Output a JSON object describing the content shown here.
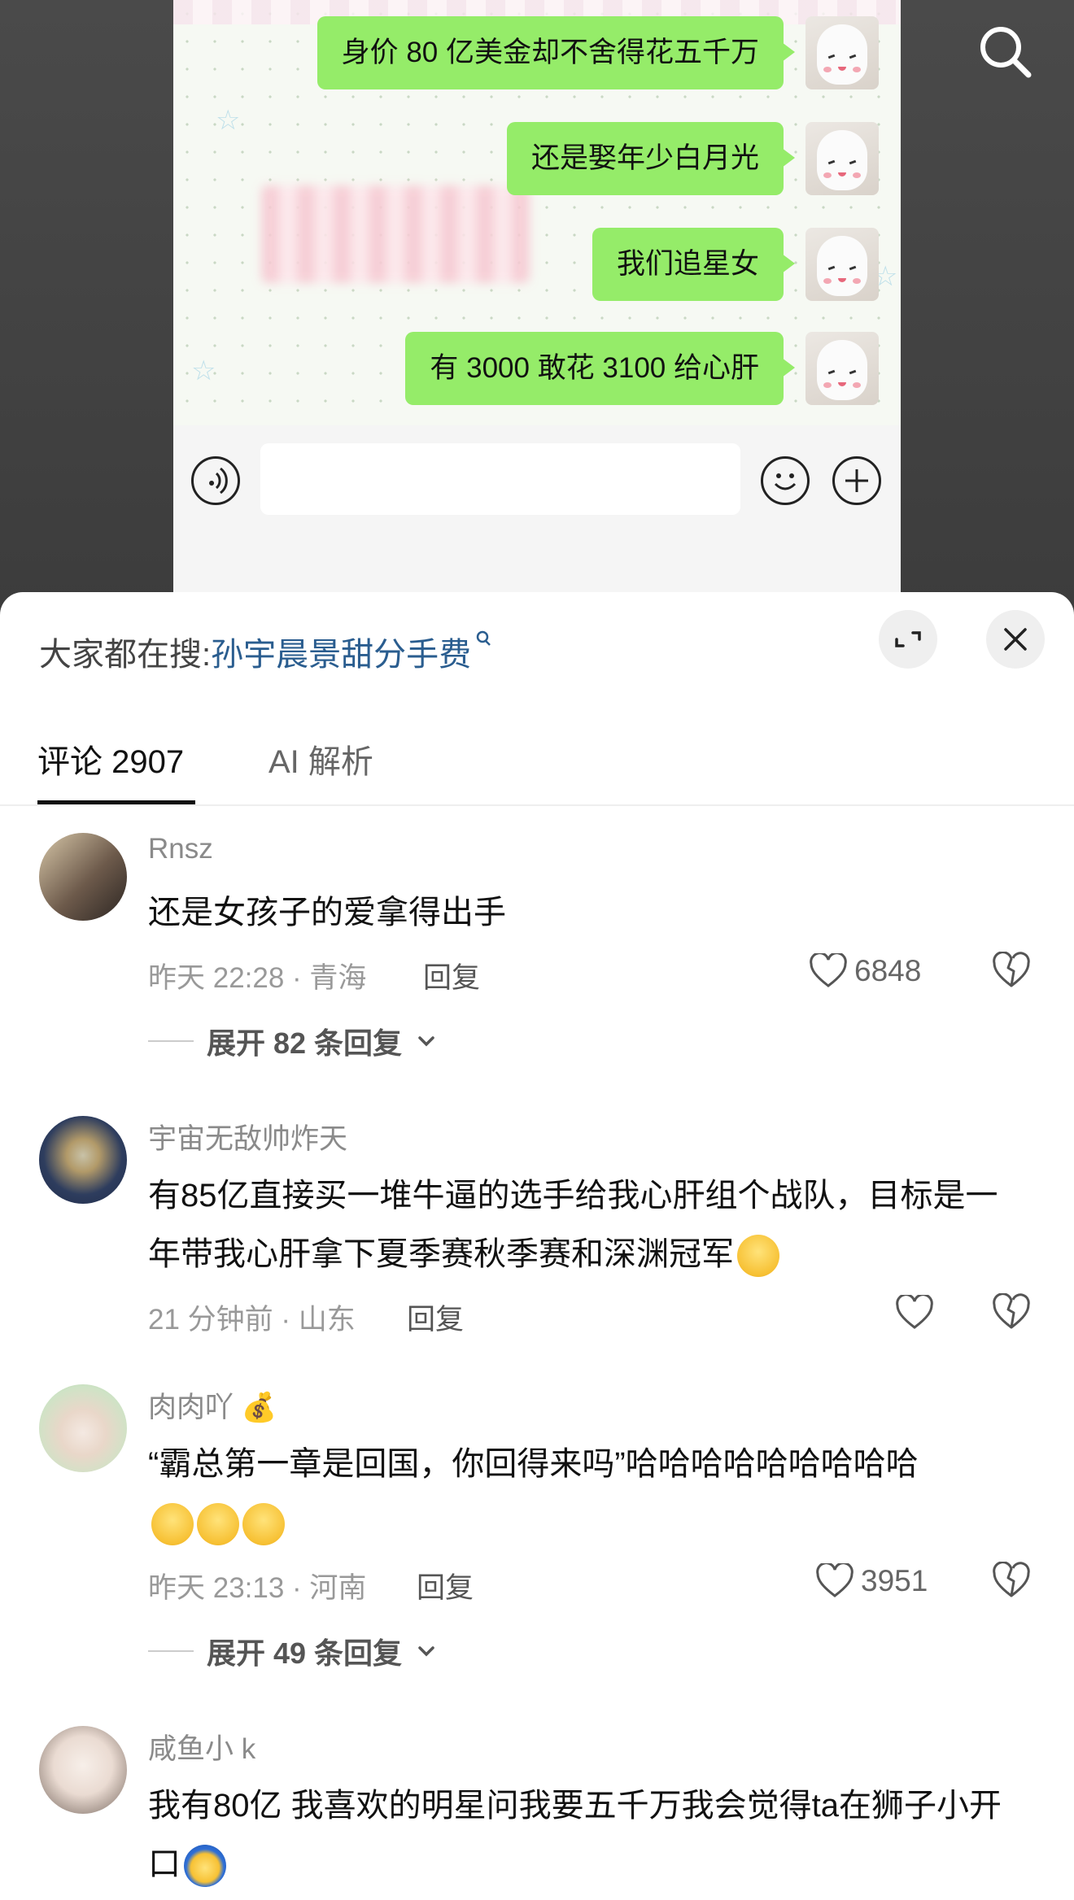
{
  "chat": {
    "messages": [
      "身价 80 亿美金却不舍得花五千万",
      "还是娶年少白月光",
      "我们追星女",
      "有 3000 敢花 3100 给心肝"
    ]
  },
  "sheet": {
    "trending_label": "大家都在搜:",
    "trending_query": "孙宇晨景甜分手费"
  },
  "tabs": [
    {
      "label": "评论 2907"
    },
    {
      "label": "AI 解析"
    }
  ],
  "comments": [
    {
      "user": "Rnsz",
      "text": "还是女孩子的爱拿得出手",
      "meta": "昨天 22:28 · 青海",
      "reply_label": "回复",
      "likes": "6848",
      "expand": "展开 82 条回复"
    },
    {
      "user": "宇宙无敌帅炸天",
      "text": "有85亿直接买一堆牛逼的选手给我心肝组个战队，目标是一年带我心肝拿下夏季赛秋季赛和深渊冠军",
      "meta": "21 分钟前 · 山东",
      "reply_label": "回复",
      "likes": ""
    },
    {
      "user": "肉肉吖",
      "text": "“霸总第一章是回国，你回得来吗”哈哈哈哈哈哈哈哈哈",
      "meta": "昨天 23:13 · 河南",
      "reply_label": "回复",
      "likes": "3951",
      "expand": "展开 49 条回复"
    },
    {
      "user": "咸鱼小 k",
      "text": "我有80亿 我喜欢的明星问我要五千万我会觉得ta在狮子小开口"
    }
  ],
  "colors": {
    "chat_bubble": "#95ec69",
    "link": "#2a5d8f",
    "tab_underline": "#111111"
  },
  "icons": {
    "search": "search-icon",
    "voice": "voice-icon",
    "emoji": "emoji-icon",
    "plus": "plus-icon",
    "expand": "expand-icon",
    "close": "close-icon",
    "like": "heart-icon",
    "dislike": "broken-heart-icon",
    "chevron": "chevron-down-icon"
  }
}
